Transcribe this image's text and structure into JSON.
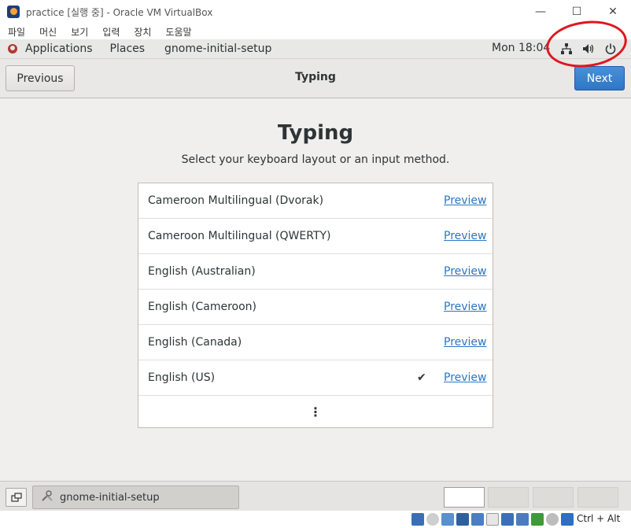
{
  "window": {
    "title": "practice [실행 중] - Oracle VM VirtualBox",
    "minimize": "—",
    "maximize": "☐",
    "close": "✕"
  },
  "host_menu": [
    "파일",
    "머신",
    "보기",
    "입력",
    "장치",
    "도움말"
  ],
  "gnome_topbar": {
    "applications": "Applications",
    "places": "Places",
    "active_app": "gnome-initial-setup",
    "clock": "Mon 18:04"
  },
  "headerbar": {
    "previous": "Previous",
    "title": "Typing",
    "next": "Next"
  },
  "page": {
    "heading": "Typing",
    "subtitle": "Select your keyboard layout or an input method."
  },
  "layouts": [
    {
      "label": "Cameroon Multilingual (Dvorak)",
      "preview": "Preview",
      "selected": false
    },
    {
      "label": "Cameroon Multilingual (QWERTY)",
      "preview": "Preview",
      "selected": false
    },
    {
      "label": "English (Australian)",
      "preview": "Preview",
      "selected": false
    },
    {
      "label": "English (Cameroon)",
      "preview": "Preview",
      "selected": false
    },
    {
      "label": "English (Canada)",
      "preview": "Preview",
      "selected": false
    },
    {
      "label": "English (US)",
      "preview": "Preview",
      "selected": true,
      "check": "✔"
    }
  ],
  "more": "⋮",
  "bottom_panel": {
    "task_label": "gnome-initial-setup"
  },
  "statusbar": {
    "host_key": "Ctrl + Alt"
  },
  "colors": {
    "accent_blue": "#2d77c6",
    "link_blue": "#2a76c6",
    "annotation_red": "#e0161e"
  }
}
